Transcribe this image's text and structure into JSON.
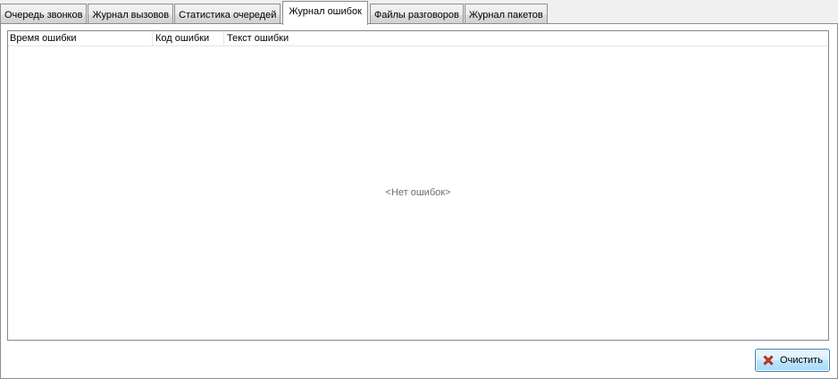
{
  "tabs": [
    {
      "label": "Очередь звонков",
      "active": false
    },
    {
      "label": "Журнал вызовов",
      "active": false
    },
    {
      "label": "Статистика очередей",
      "active": false
    },
    {
      "label": "Журнал ошибок",
      "active": true
    },
    {
      "label": "Файлы разговоров",
      "active": false
    },
    {
      "label": "Журнал пакетов",
      "active": false
    }
  ],
  "error_log": {
    "columns": [
      "Время ошибки",
      "Код ошибки",
      "Текст ошибки"
    ],
    "rows": [],
    "empty_text": "<Нет ошибок>"
  },
  "toolbar": {
    "clear_label": "Очистить",
    "clear_icon": "red-x-icon"
  },
  "colors": {
    "clear_icon": "#d9342b",
    "button_border": "#3c7fb1"
  }
}
